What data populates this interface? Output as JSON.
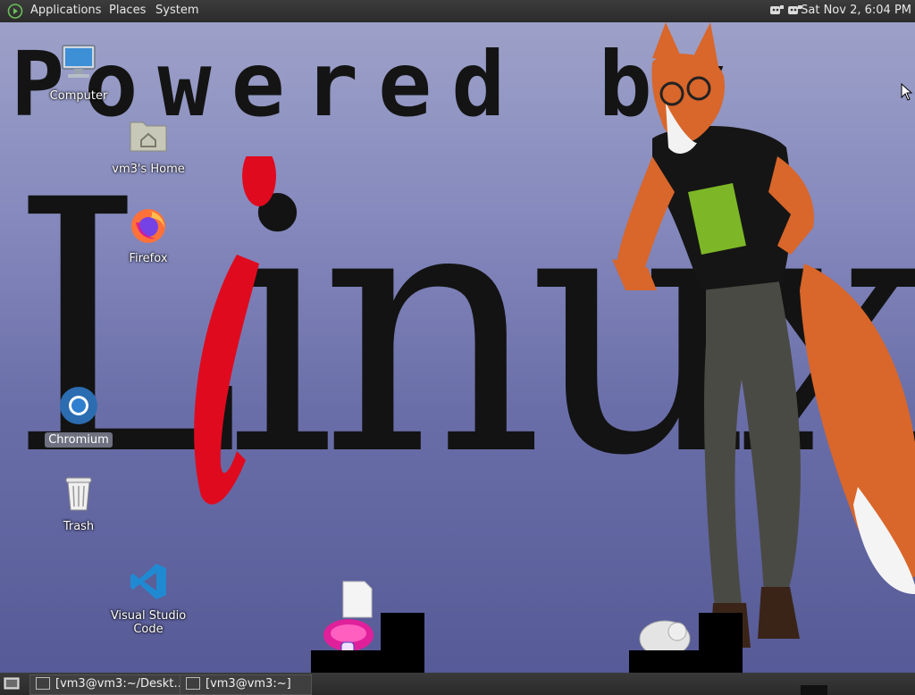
{
  "top_panel": {
    "menus": [
      "Applications",
      "Places",
      "System"
    ],
    "clock": "Sat Nov 2,  6:04 PM"
  },
  "wallpaper": {
    "powered_text": "Powered by",
    "linux_text": "Linux"
  },
  "desktop_icons": {
    "computer": "Computer",
    "home": "vm3's Home",
    "firefox": "Firefox",
    "chromium": "Chromium",
    "trash": "Trash",
    "vscode": "Visual Studio Code"
  },
  "taskbar": {
    "tasks": [
      "[vm3@vm3:~/Deskt…",
      "[vm3@vm3:~]"
    ]
  },
  "colors": {
    "panel": "#2b2b2b",
    "wallpaper_top": "#9da1c8",
    "wallpaper_bottom": "#565a96",
    "linux_i_red": "#e00a1e",
    "vscode_blue": "#1f8ad2",
    "chromium_blue": "#2c6cb0"
  }
}
